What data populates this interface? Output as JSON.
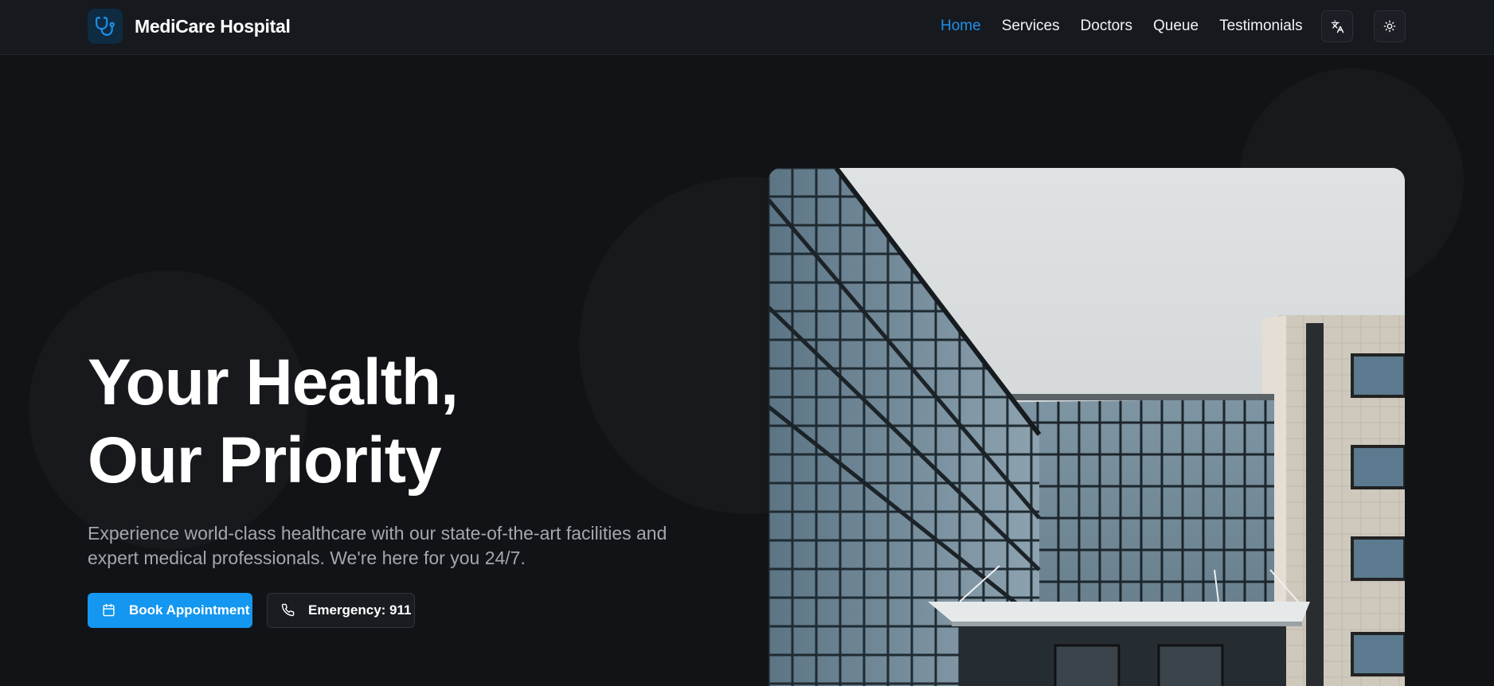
{
  "header": {
    "brand_name": "MediCare Hospital",
    "logo_icon": "stethoscope-icon",
    "nav": [
      {
        "label": "Home",
        "active": true
      },
      {
        "label": "Services",
        "active": false
      },
      {
        "label": "Doctors",
        "active": false
      },
      {
        "label": "Queue",
        "active": false
      },
      {
        "label": "Testimonials",
        "active": false
      }
    ],
    "actions": {
      "language_icon": "translate-icon",
      "theme_icon": "sun-icon"
    }
  },
  "hero": {
    "title_line1": "Your Health,",
    "title_line2": "Our Priority",
    "description": "Experience world-class healthcare with our state-of-the-art facilities and expert medical professionals. We're here for you 24/7.",
    "primary_button": {
      "label": "Book Appointment",
      "icon": "calendar-icon"
    },
    "secondary_button": {
      "label": "Emergency: 911",
      "icon": "phone-icon"
    },
    "image": "hospital-building-photo"
  },
  "colors": {
    "background": "#111317",
    "navbar": "#16191e",
    "accent": "#1497f0",
    "active_link": "#1e90e8",
    "muted_text": "#a3a7ae"
  }
}
